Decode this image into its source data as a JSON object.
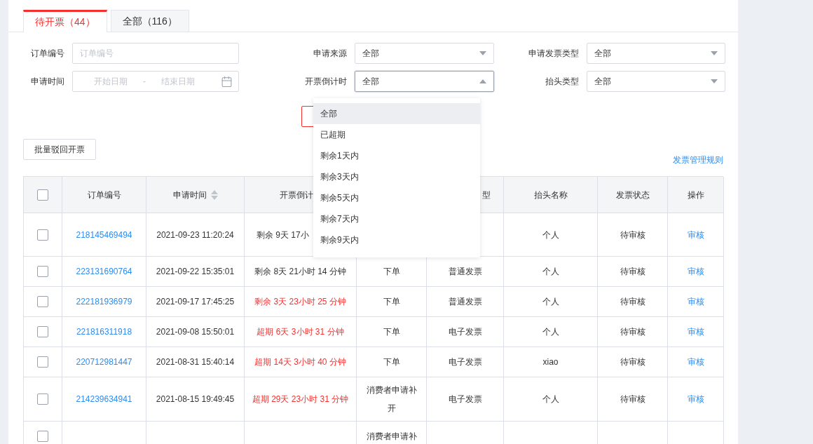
{
  "tabs": [
    {
      "label": "待开票（44）",
      "selected": true
    },
    {
      "label": "全部（116）",
      "selected": false
    }
  ],
  "filters": [
    {
      "kind": "text",
      "label": "订单编号",
      "placeholder": "订单编号"
    },
    {
      "kind": "select",
      "label": "申请来源",
      "value": "全部",
      "open": false
    },
    {
      "kind": "select",
      "label": "申请发票类型",
      "value": "全部",
      "open": false
    },
    {
      "kind": "daterange",
      "label": "申请时间",
      "start_placeholder": "开始日期",
      "separator": "-",
      "end_placeholder": "结束日期"
    },
    {
      "kind": "select",
      "label": "开票倒计时",
      "value": "全部",
      "open": true
    },
    {
      "kind": "select",
      "label": "抬头类型",
      "value": "全部",
      "open": false
    }
  ],
  "dropdown": {
    "options": [
      {
        "label": "全部",
        "selected": true
      },
      {
        "label": "已超期",
        "selected": false
      },
      {
        "label": "剩余1天内",
        "selected": false
      },
      {
        "label": "剩余3天内",
        "selected": false
      },
      {
        "label": "剩余5天内",
        "selected": false
      },
      {
        "label": "剩余7天内",
        "selected": false
      },
      {
        "label": "剩余9天内",
        "selected": false
      }
    ]
  },
  "batch_button": "批量驳回开票",
  "rules_link": "发票管理规则",
  "table": {
    "header_checked": false,
    "columns": [
      {
        "label": "订单编号"
      },
      {
        "label": "申请时间",
        "sortable": true
      },
      {
        "label": "开票倒计"
      },
      {},
      {
        "label": "型"
      },
      {
        "label": "抬头名称"
      },
      {
        "label": "发票状态"
      },
      {
        "label": "操作"
      }
    ],
    "rows": [
      {
        "checked": false,
        "order": "218145469494",
        "time": "2021-09-23 11:20:24",
        "countdown": "剩余 9天 17小",
        "highlight": false,
        "title": "个人",
        "status": "待审核",
        "action": "审核"
      },
      {
        "checked": false,
        "order": "223131690764",
        "time": "2021-09-22 15:35:01",
        "countdown": "剩余 8天 21小时 14 分钟",
        "highlight": false,
        "source": "下单",
        "invoice_type": "普通发票",
        "title": "个人",
        "status": "待审核",
        "action": "审核"
      },
      {
        "checked": false,
        "order": "222181936979",
        "time": "2021-09-17 17:45:25",
        "countdown": "剩余 3天 23小时 25 分钟",
        "highlight": true,
        "source": "下单",
        "invoice_type": "普通发票",
        "title": "个人",
        "status": "待审核",
        "action": "审核"
      },
      {
        "checked": false,
        "order": "221816311918",
        "time": "2021-09-08 15:50:01",
        "countdown": "超期 6天 3小时 31 分钟",
        "highlight": true,
        "source": "下单",
        "invoice_type": "电子发票",
        "title": "个人",
        "status": "待审核",
        "action": "审核"
      },
      {
        "checked": false,
        "order": "220712981447",
        "time": "2021-08-31 15:40:14",
        "countdown": "超期 14天 3小时 40 分钟",
        "highlight": true,
        "source": "下单",
        "invoice_type": "电子发票",
        "title": "xiao",
        "status": "待审核",
        "action": "审核"
      },
      {
        "checked": false,
        "order": "214239634941",
        "time": "2021-08-15 19:49:45",
        "countdown": "超期 29天 23小时 31 分钟",
        "highlight": true,
        "source": "消费者申请补开",
        "invoice_type": "电子发票",
        "title": "个人",
        "status": "待审核",
        "action": "审核"
      },
      {
        "checked": false,
        "source": "消费者申请补"
      }
    ]
  }
}
